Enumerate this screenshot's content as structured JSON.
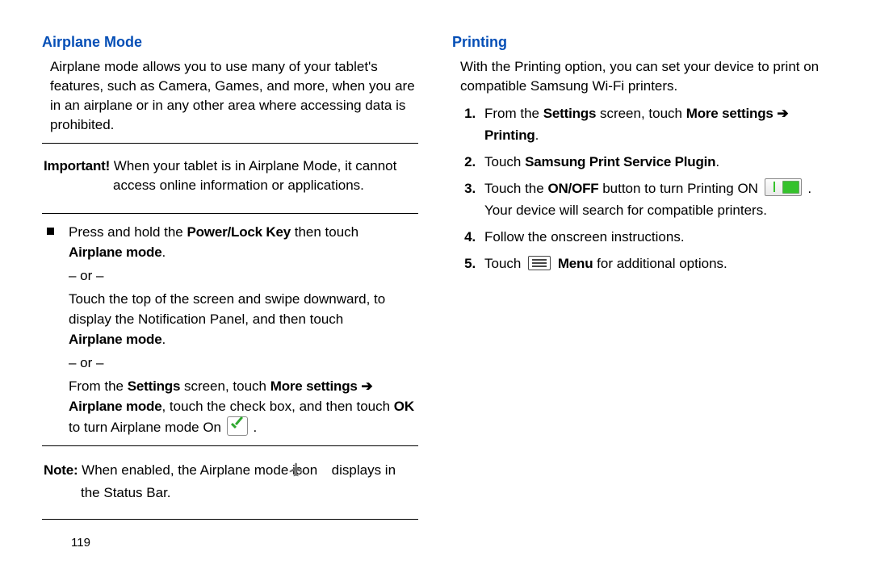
{
  "left": {
    "heading": "Airplane Mode",
    "intro": "Airplane mode allows you to use many of your tablet's features, such as Camera, Games, and more, when you are in an airplane or in any other area where accessing data is prohibited.",
    "important_label": "Important!",
    "important_body": " When your tablet is in Airplane Mode, it cannot access online information or applications.",
    "b1_a": "Press and hold the ",
    "b1_b": "Power/Lock Key",
    "b1_c": " then touch ",
    "b1_d": "Airplane mode",
    "b1_e": ".",
    "or": "– or –",
    "b2_a": "Touch the top of the screen and swipe downward, to display the Notification Panel, and then touch ",
    "b2_b": "Airplane mode",
    "b2_c": ".",
    "b3_a": "From the ",
    "b3_b": "Settings",
    "b3_c": " screen, touch ",
    "b3_d": "More settings",
    "b3_arrow": " ➔ ",
    "b3_e": "Airplane mode",
    "b3_f": ", touch the check box, and then touch ",
    "b3_g": "OK",
    "b3_h": " to turn Airplane mode On ",
    "b3_i": " .",
    "note_label": "Note:",
    "note_a": " When enabled, the Airplane mode icon ",
    "note_b": " displays in the Status Bar.",
    "page": "119"
  },
  "right": {
    "heading": "Printing",
    "intro": "With the Printing option, you can set your device to print on compatible Samsung Wi-Fi printers.",
    "s1_a": "From the ",
    "s1_b": "Settings",
    "s1_c": " screen, touch ",
    "s1_d": "More settings",
    "s1_arrow": " ➔ ",
    "s1_e": "Printing",
    "s1_f": ".",
    "s2_a": "Touch ",
    "s2_b": "Samsung Print Service Plugin",
    "s2_c": ".",
    "s3_a": "Touch the ",
    "s3_b": "ON/OFF",
    "s3_c": " button to turn Printing ON ",
    "s3_d": " . Your device will search for compatible printers.",
    "s4": "Follow the onscreen instructions.",
    "s5_a": "Touch ",
    "s5_b": "Menu",
    "s5_c": " for additional options."
  }
}
